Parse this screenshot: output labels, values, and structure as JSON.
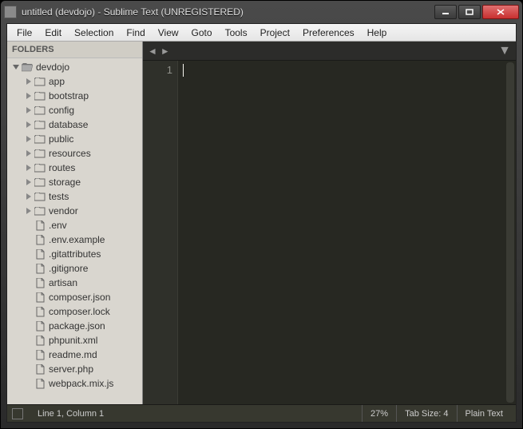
{
  "window": {
    "title": "untitled (devdojo) - Sublime Text (UNREGISTERED)"
  },
  "menu": {
    "items": [
      "File",
      "Edit",
      "Selection",
      "Find",
      "View",
      "Goto",
      "Tools",
      "Project",
      "Preferences",
      "Help"
    ]
  },
  "sidebar": {
    "header": "FOLDERS",
    "root": {
      "name": "devdojo",
      "expanded": true
    },
    "folders": [
      "app",
      "bootstrap",
      "config",
      "database",
      "public",
      "resources",
      "routes",
      "storage",
      "tests",
      "vendor"
    ],
    "files": [
      ".env",
      ".env.example",
      ".gitattributes",
      ".gitignore",
      "artisan",
      "composer.json",
      "composer.lock",
      "package.json",
      "phpunit.xml",
      "readme.md",
      "server.php",
      "webpack.mix.js"
    ]
  },
  "editor": {
    "gutter_line": "1",
    "tab_left": "◄",
    "tab_right": "►",
    "tab_dropdown": "▼"
  },
  "status": {
    "position": "Line 1, Column 1",
    "zoom": "27%",
    "tabsize": "Tab Size: 4",
    "syntax": "Plain Text"
  }
}
